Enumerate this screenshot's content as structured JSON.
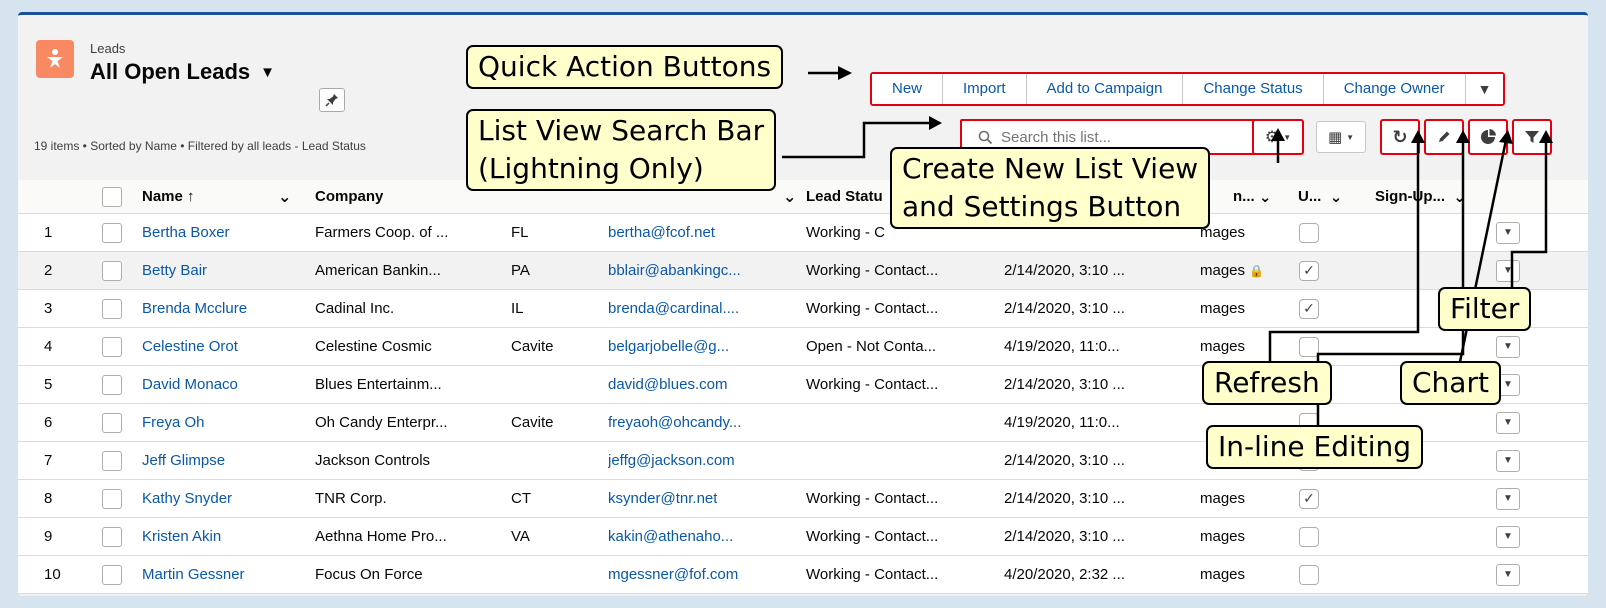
{
  "header": {
    "object_label": "Leads",
    "view_title": "All Open Leads",
    "meta": "19 items • Sorted by Name • Filtered by all leads - Lead Status"
  },
  "quick_actions": [
    "New",
    "Import",
    "Add to Campaign",
    "Change Status",
    "Change Owner"
  ],
  "search": {
    "placeholder": "Search this list..."
  },
  "columns": {
    "name": "Name ↑",
    "company": "Company",
    "lead_status": "Lead Statu",
    "owner": "n...",
    "unread": "U...",
    "signup": "Sign-Up..."
  },
  "rows": [
    {
      "num": "1",
      "name": "Bertha Boxer",
      "company": "Farmers Coop. of ...",
      "state": "FL",
      "email": "bertha@fcof.net",
      "status": "Working - C",
      "date": "",
      "owner": "mages",
      "lock": false,
      "checked": false
    },
    {
      "num": "2",
      "name": "Betty Bair",
      "company": "American Bankin...",
      "state": "PA",
      "email": "bblair@abankingc...",
      "status": "Working - Contact...",
      "date": "2/14/2020, 3:10 ...",
      "owner": "mages",
      "lock": true,
      "checked": true
    },
    {
      "num": "3",
      "name": "Brenda Mcclure",
      "company": "Cadinal Inc.",
      "state": "IL",
      "email": "brenda@cardinal....",
      "status": "Working - Contact...",
      "date": "2/14/2020, 3:10 ...",
      "owner": "mages",
      "lock": false,
      "checked": true
    },
    {
      "num": "4",
      "name": "Celestine Orot",
      "company": "Celestine Cosmic",
      "state": "Cavite",
      "email": "belgarjobelle@g...",
      "status": "Open - Not Conta...",
      "date": "4/19/2020, 11:0...",
      "owner": "mages",
      "lock": false,
      "checked": false
    },
    {
      "num": "5",
      "name": "David Monaco",
      "company": "Blues Entertainm...",
      "state": "",
      "email": "david@blues.com",
      "status": "Working - Contact...",
      "date": "2/14/2020, 3:10 ...",
      "owner": "",
      "lock": false,
      "checked": false
    },
    {
      "num": "6",
      "name": "Freya Oh",
      "company": "Oh Candy Enterpr...",
      "state": "Cavite",
      "email": "freyaoh@ohcandy...",
      "status": "",
      "date": "4/19/2020, 11:0...",
      "owner": "",
      "lock": false,
      "checked": false
    },
    {
      "num": "7",
      "name": "Jeff Glimpse",
      "company": "Jackson Controls",
      "state": "",
      "email": "jeffg@jackson.com",
      "status": "",
      "date": "2/14/2020, 3:10 ...",
      "owner": "",
      "lock": false,
      "checked": false
    },
    {
      "num": "8",
      "name": "Kathy Snyder",
      "company": "TNR Corp.",
      "state": "CT",
      "email": "ksynder@tnr.net",
      "status": "Working - Contact...",
      "date": "2/14/2020, 3:10 ...",
      "owner": "mages",
      "lock": false,
      "checked": true
    },
    {
      "num": "9",
      "name": "Kristen Akin",
      "company": "Aethna Home Pro...",
      "state": "VA",
      "email": "kakin@athenaho...",
      "status": "Working - Contact...",
      "date": "2/14/2020, 3:10 ...",
      "owner": "mages",
      "lock": false,
      "checked": false
    },
    {
      "num": "10",
      "name": "Martin Gessner",
      "company": "Focus On Force",
      "state": "",
      "email": "mgessner@fof.com",
      "status": "Working - Contact...",
      "date": "4/20/2020, 2:32 ...",
      "owner": "mages",
      "lock": false,
      "checked": false
    }
  ],
  "callouts": {
    "quick_action": "Quick Action Buttons",
    "search_line1": "List View Search Bar",
    "search_line2": "(Lightning Only)",
    "settings_line1": "Create New List View",
    "settings_line2": "and Settings Button",
    "filter": "Filter",
    "refresh": "Refresh",
    "chart": "Chart",
    "inline": "In-line Editing"
  },
  "colors": {
    "accent_red": "#e4000f",
    "callout_fill": "#ffffcc",
    "lead_icon": "#f88962",
    "link": "#0a58a8"
  }
}
